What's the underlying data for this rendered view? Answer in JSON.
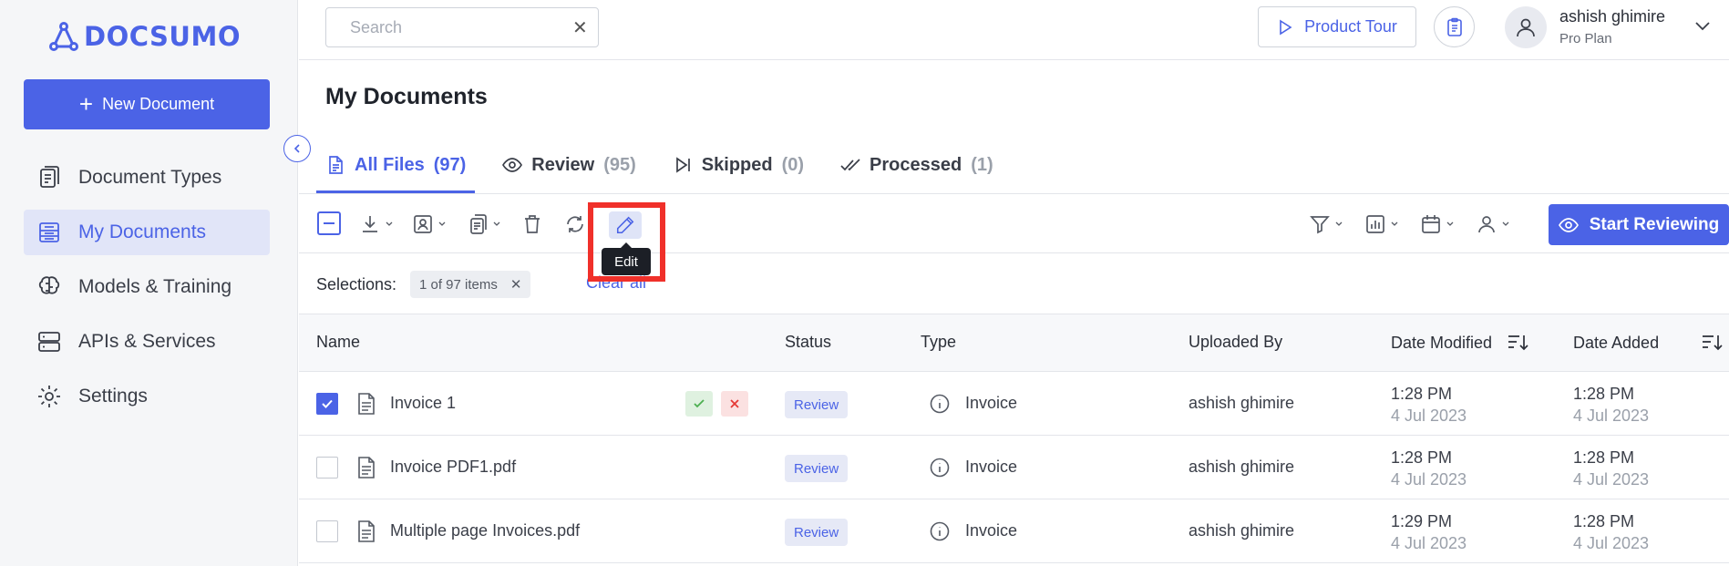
{
  "brand": {
    "name": "DOCSUMO",
    "color": "#4b63e6"
  },
  "sidebar": {
    "new_document": "New Document",
    "items": [
      {
        "label": "Document Types",
        "icon": "document-types-icon",
        "active": false
      },
      {
        "label": "My Documents",
        "icon": "my-documents-icon",
        "active": true
      },
      {
        "label": "Models & Training",
        "icon": "brain-icon",
        "active": false
      },
      {
        "label": "APIs & Services",
        "icon": "server-icon",
        "active": false
      },
      {
        "label": "Settings",
        "icon": "gear-icon",
        "active": false
      }
    ]
  },
  "header": {
    "search_placeholder": "Search",
    "product_tour": "Product Tour",
    "user_name": "ashish ghimire",
    "user_plan": "Pro Plan"
  },
  "main": {
    "title": "My Documents",
    "tabs": [
      {
        "label": "All Files",
        "count": "(97)",
        "active": true
      },
      {
        "label": "Review",
        "count": "(95)",
        "active": false
      },
      {
        "label": "Skipped",
        "count": "(0)",
        "active": false
      },
      {
        "label": "Processed",
        "count": "(1)",
        "active": false
      }
    ],
    "toolbar": {
      "edit_tooltip": "Edit",
      "start_reviewing": "Start Reviewing"
    },
    "selections": {
      "label": "Selections:",
      "chip": "1 of 97 items",
      "clear_all": "Clear all"
    }
  },
  "table": {
    "columns": [
      "Name",
      "Status",
      "Type",
      "Uploaded By",
      "Date Modified",
      "Date Added"
    ],
    "rows": [
      {
        "checked": true,
        "name": "Invoice 1",
        "status": "Review",
        "type": "Invoice",
        "uploaded_by": "ashish ghimire",
        "modified_time": "1:28 PM",
        "modified_date": "4 Jul 2023",
        "added_time": "1:28 PM",
        "added_date": "4 Jul 2023",
        "quick_actions": true
      },
      {
        "checked": false,
        "name": "Invoice PDF1.pdf",
        "status": "Review",
        "type": "Invoice",
        "uploaded_by": "ashish ghimire",
        "modified_time": "1:28 PM",
        "modified_date": "4 Jul 2023",
        "added_time": "1:28 PM",
        "added_date": "4 Jul 2023",
        "quick_actions": false
      },
      {
        "checked": false,
        "name": "Multiple page Invoices.pdf",
        "status": "Review",
        "type": "Invoice",
        "uploaded_by": "ashish ghimire",
        "modified_time": "1:29 PM",
        "modified_date": "4 Jul 2023",
        "added_time": "1:28 PM",
        "added_date": "4 Jul 2023",
        "quick_actions": false
      }
    ]
  },
  "colors": {
    "accent": "#4b63e6",
    "highlight": "#f0302a",
    "approve": "#4caf50",
    "reject": "#e53935"
  }
}
